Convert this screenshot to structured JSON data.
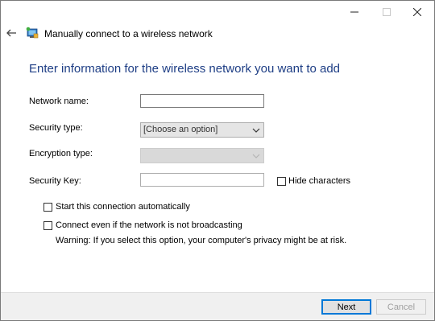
{
  "window": {
    "title": "Manually connect to a wireless network",
    "controls": {
      "minimize_icon": "minimize-icon",
      "maximize_icon": "maximize-icon",
      "close_icon": "close-icon"
    }
  },
  "heading": "Enter information for the wireless network you want to add",
  "form": {
    "network_name": {
      "label": "Network name:",
      "value": ""
    },
    "security_type": {
      "label": "Security type:",
      "selected": "[Choose an option]"
    },
    "encryption_type": {
      "label": "Encryption type:",
      "selected": "",
      "disabled": true
    },
    "security_key": {
      "label": "Security Key:",
      "value": ""
    },
    "hide_characters": {
      "label": "Hide characters",
      "checked": false
    },
    "start_automatically": {
      "label": "Start this connection automatically",
      "checked": false
    },
    "connect_not_broadcasting": {
      "label": "Connect even if the network is not broadcasting",
      "checked": false
    },
    "warning": "Warning: If you select this option, your computer's privacy might be at risk."
  },
  "footer": {
    "next_label": "Next",
    "cancel_label": "Cancel"
  },
  "colors": {
    "heading": "#1e3e85",
    "accent": "#0078d7",
    "footer_bg": "#f0f0f0"
  }
}
